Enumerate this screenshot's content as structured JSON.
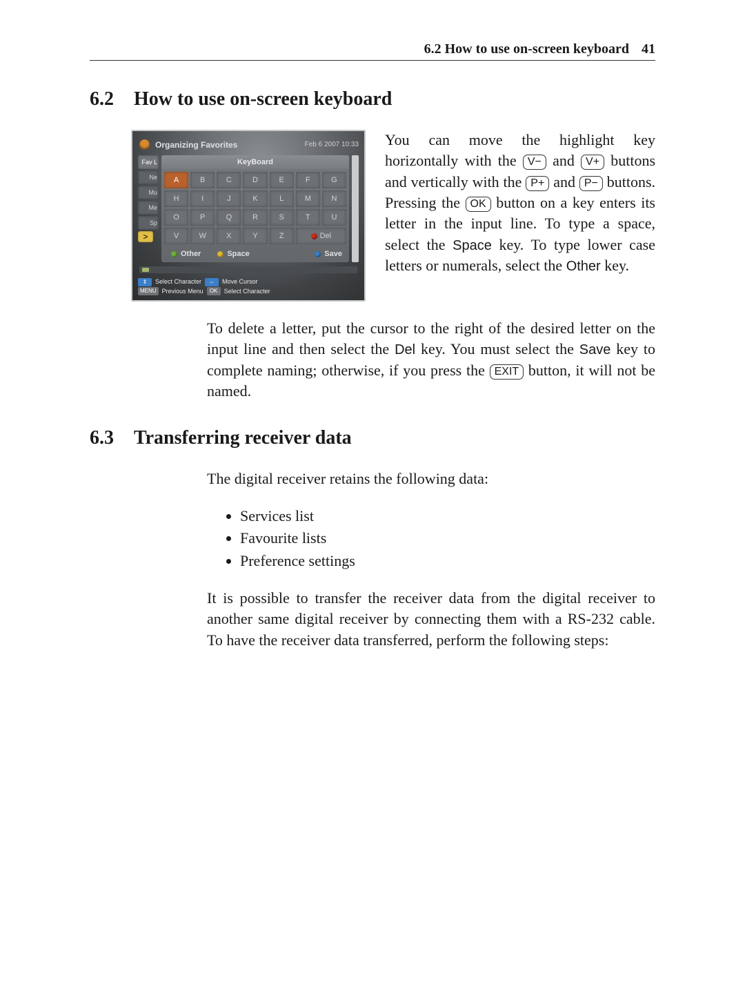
{
  "header": {
    "section_label": "6.2 How to use on-screen keyboard",
    "page_number": "41"
  },
  "section62": {
    "number": "6.2",
    "title": "How to use on-screen keyboard"
  },
  "section63": {
    "number": "6.3",
    "title": "Transferring receiver data"
  },
  "keys": {
    "vminus": "V−",
    "vplus": "V+",
    "pplus": "P+",
    "pminus": "P−",
    "ok": "OK",
    "exit": "EXIT"
  },
  "ui_words": {
    "space": "Space",
    "other": "Other",
    "del": "Del",
    "save": "Save"
  },
  "para": {
    "right1a": "You can move the highlight key horizontally with the ",
    "right1b": " and ",
    "right1c": " buttons and vertically with the ",
    "right1d": " and ",
    "right1e": " buttons. Pressing the ",
    "right1f": " button on a key enters its letter in the input line. To type a space, select the ",
    "right1g": " key. To type lower case letters or numerals, select the ",
    "right1h": " key.",
    "p2a": "To delete a letter, put the cursor to the right of the desired letter on the input line and then select the ",
    "p2b": " key. You must select the ",
    "p2c": " key to complete naming; otherwise, if you press the ",
    "p2d": " button, it will not be named.",
    "p3": "The digital receiver retains the following data:",
    "p4": "It is possible to transfer the receiver data from the digital receiver to another same digital receiver by connecting them with a RS-232 cable. To have the receiver data transferred, perform the following steps:"
  },
  "list63": [
    "Services list",
    "Favourite lists",
    "Preference settings"
  ],
  "device": {
    "title": "Organizing Favorites",
    "date": "Feb 6 2007 10:33",
    "panel_title": "KeyBoard",
    "tabs": [
      "Fav L",
      "Ne",
      "Mu",
      "Me",
      "Sp"
    ],
    "rows": [
      [
        "A",
        "B",
        "C",
        "D",
        "E",
        "F",
        "G"
      ],
      [
        "H",
        "I",
        "J",
        "K",
        "L",
        "M",
        "N"
      ],
      [
        "O",
        "P",
        "Q",
        "R",
        "S",
        "T",
        "U"
      ],
      [
        "V",
        "W",
        "X",
        "Y",
        "Z"
      ]
    ],
    "del_label": "Del",
    "actions": {
      "other": "Other",
      "space": "Space",
      "save": "Save"
    },
    "hints": {
      "select_char": "Select Character",
      "move_cursor": "Move Cursor",
      "menu": "MENU",
      "prev_menu": "Previous Menu",
      "ok": "OK",
      "select_char2": "Select Character"
    }
  }
}
